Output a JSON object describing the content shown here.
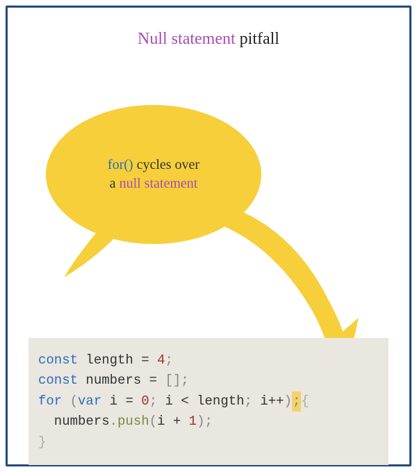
{
  "title": {
    "highlight": "Null statement",
    "rest": " pitfall"
  },
  "bubble": {
    "for_keyword": "for()",
    "line1_rest": " cycles over",
    "line2_pre": "a ",
    "line2_hl": "null statement"
  },
  "code": {
    "kw_const1": "const",
    "id_length": "length",
    "op_eq1": "=",
    "num_4": "4",
    "semi1": ";",
    "kw_const2": "const",
    "id_numbers": "numbers",
    "op_eq2": "=",
    "arr_open": "[",
    "arr_close": "]",
    "semi2": ";",
    "kw_for": "for",
    "paren_open": "(",
    "kw_var": "var",
    "id_i": "i",
    "op_eq3": "=",
    "num_0": "0",
    "semi3": ";",
    "id_i2": "i",
    "op_lt": "<",
    "id_length2": "length",
    "semi4": ";",
    "id_i3": "i",
    "op_inc": "++",
    "paren_close": ")",
    "stray_semi": ";",
    "brace_open": "{",
    "id_numbers2": "numbers",
    "dot": ".",
    "fn_push": "push",
    "paren_open2": "(",
    "id_i4": "i",
    "op_plus": "+",
    "num_1": "1",
    "paren_close2": ")",
    "semi5": ";",
    "brace_close": "}"
  },
  "colors": {
    "bubble": "#f6cf3a",
    "frame": "#1e4a7a",
    "codebg": "#eae7e1",
    "purple": "#a94bb5",
    "blue": "#2a6db5"
  }
}
